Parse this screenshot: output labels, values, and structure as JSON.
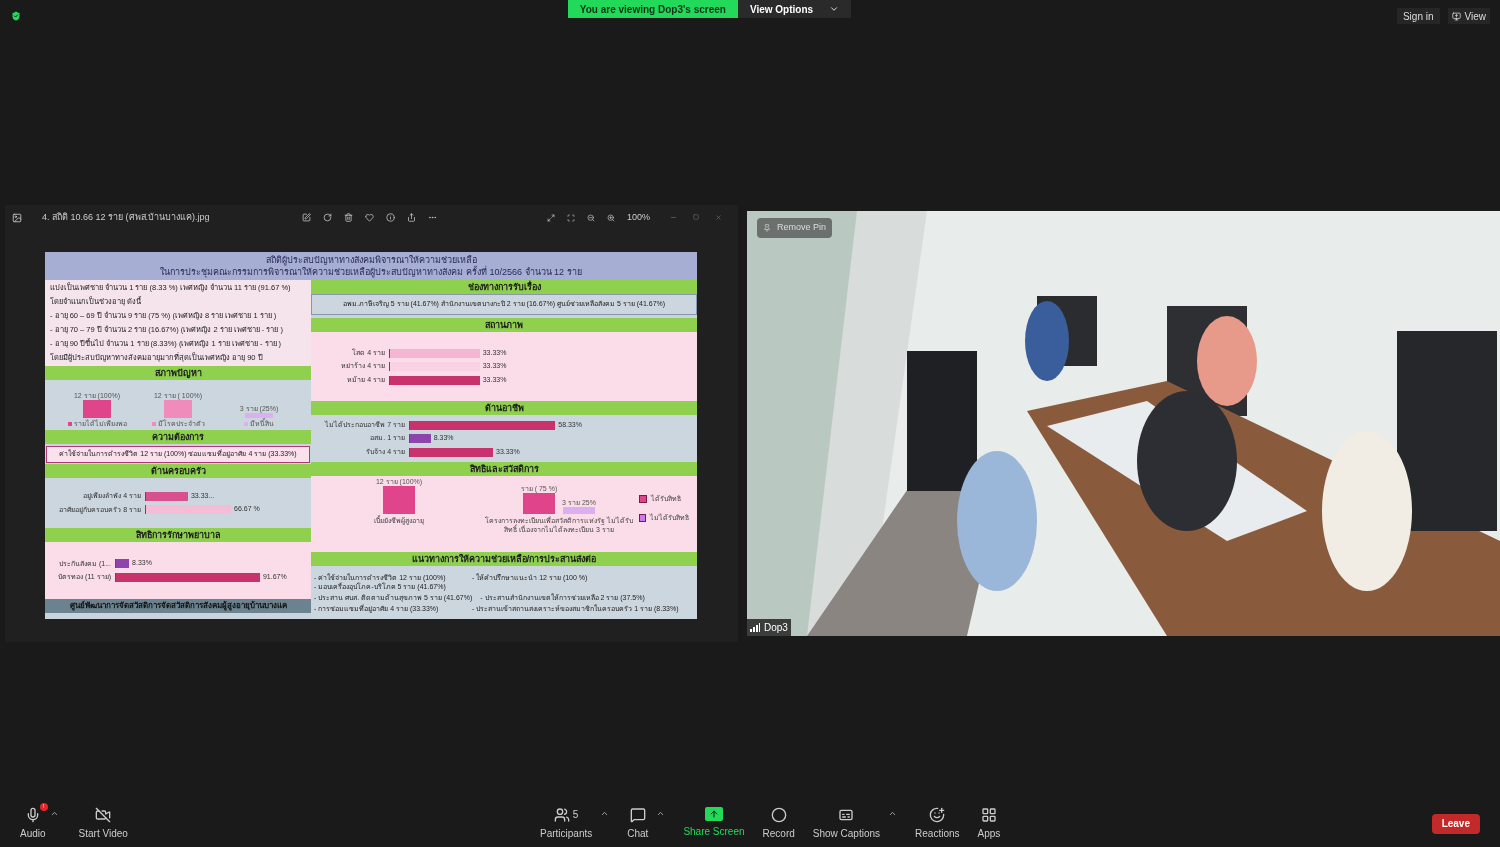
{
  "top_bar": {
    "banner": "You are viewing Dop3's screen",
    "view_options": "View Options",
    "sign_in": "Sign in",
    "view": "View"
  },
  "viewer": {
    "file_name": "4. สถิติ 10.66  12 ราย (ศพส.บ้านบางแค).jpg",
    "zoom": "100%"
  },
  "slide": {
    "title": [
      "สถิติผู้ประสบปัญหาทางสังคมพิจารณาให้ความช่วยเหลือ",
      "ในการประชุมคณะกรรมการพิจารณาให้ความช่วยเหลือผู้ประสบปัญหาทางสังคม ครั้งที่ 10/2566 จำนวน  12 ราย"
    ],
    "intro": [
      "แบ่งเป็นเพศชาย จำนวน 1 ราย (8.33 %) เพศหญิง จำนวน 11 ราย (91.67 %)",
      "โดยจำแนกเป็นช่วงอายุ ดังนี้",
      "-  อายุ 60 – 69 ปี จำนวน 9 ราย (75 %) (เพศหญิง 8 ราย เพศชาย 1 ราย )",
      "-  อายุ 70 – 79 ปี จำนวน 2 ราย (16.67%) (เพศหญิง 2 ราย เพศชาย - ราย )",
      "-  อายุ 90 ปีขึ้นไป จำนวน 1 ราย (8.33%) (เพศหญิง 1 ราย เพศชาย - ราย )",
      "โดยมีผู้ประสบปัญหาทางสังคมอายุมากที่สุดเป็นเพศหญิง อายุ 90 ปี"
    ],
    "problems": {
      "heading": "สภาพปัญหา",
      "bars": [
        {
          "value_label": "12 ราย (100%)",
          "color": "#e0448a"
        },
        {
          "value_label": "12 ราย ( 100%)",
          "color": "#f08cbc"
        },
        {
          "value_label": "3 ราย (25%)",
          "color": "#dcb0f0"
        }
      ],
      "legend": [
        "รายได้ไม่เพียงพอ",
        "มีโรคประจำตัว",
        "มีหนี้สิน"
      ]
    },
    "needs": {
      "heading": "ความต้องการ",
      "text": "ค่าใช้จ่ายในการดำรงชีวิต 12 ราย (100%)  ซ่อมแซมที่อยู่อาศัย 4 ราย (33.33%)"
    },
    "family": {
      "heading": "ด้านครอบครัว",
      "rows": [
        {
          "label": "อยู่เพียงลำพัง 4 ราย",
          "value": "33.33...",
          "level": 0.33,
          "color": "#d9508f"
        },
        {
          "label": "อาศัยอยู่กับครอบครัว 8 ราย",
          "value": "66.67  %",
          "level": 0.67,
          "color": "#f5bcd6"
        }
      ]
    },
    "medical": {
      "heading": "สิทธิการรักษาพยาบาล",
      "rows": [
        {
          "label": "ประกันสังคม (1...",
          "value": "8.33%",
          "level": 0.0833,
          "color": "#8e44ad"
        },
        {
          "label": "บัตรทอง (11 ราย)",
          "value": "91.67%",
          "level": 0.9167,
          "color": "#c8336e"
        }
      ]
    },
    "footer": "ศูนย์พัฒนาการจัดสวัสดิการจัดสวัสดิการสังคมผู้สูงอายุบ้านบางแค",
    "channels": {
      "heading": "ช่องทางการรับเรื่อง",
      "text": "อพม.ภาษีเจริญ 5 ราย (41.67%)   สำนักงานเขตบางกะปิ 2 ราย (16.67%)  ศูนย์ช่วยเหลือสังคม 5 ราย (41.67%)"
    },
    "status": {
      "heading": "สถานภาพ",
      "rows": [
        {
          "label": "โสด 4 ราย",
          "value": "33.33%",
          "level": 0.3333,
          "color": "#f4b6d2"
        },
        {
          "label": "หย่าร้าง 4 ราย",
          "value": "33.33%",
          "level": 0.3333,
          "color": "#f9d3e4"
        },
        {
          "label": "หม้าย 4 ราย",
          "value": "33.33%",
          "level": 0.3333,
          "color": "#c8336e"
        }
      ]
    },
    "occupation": {
      "heading": "ด้านอาชีพ",
      "rows": [
        {
          "label": "ไม่ได้ประกอบอาชีพ 7 ราย",
          "value": "58.33%",
          "level": 0.5833,
          "color": "#c8336e"
        },
        {
          "label": "อสม. 1 ราย",
          "value": "8.33%",
          "level": 0.0833,
          "color": "#8e44ad"
        },
        {
          "label": "รับจ้าง 4 ราย",
          "value": "33.33%",
          "level": 0.3333,
          "color": "#c8336e"
        }
      ]
    },
    "welfare": {
      "heading": "สิทธิและสวัสดิการ",
      "groups": [
        {
          "category": "เบี้ยยังชีพผู้สูงอายุ",
          "bars": [
            {
              "value_label": "12 ราย (100%)",
              "color": "#e0448a"
            }
          ]
        },
        {
          "category": "โครงการลงทะเบียนเพื่อสวัสดิการแห่งรัฐ ไม่ได้รับสิทธิ์ เนื่องจากไม่ได้ลงทะเบียน 3 ราย",
          "bars": [
            {
              "value_label": "ราย ( 75 %)",
              "color": "#e0448a"
            },
            {
              "value_label": "3 ราย 25%",
              "color": "#dcb0f0"
            }
          ]
        }
      ],
      "legend": [
        {
          "label": "ได้รับสิทธิ",
          "color": "#e0448a"
        },
        {
          "label": "ไม่ได้รับสิทธิ",
          "color": "#c87af0"
        }
      ]
    },
    "guidance": {
      "heading": "แนวทางการให้ความช่วยเหลือ/การประสานส่งต่อ",
      "lines": [
        [
          "- ค่าใช้จ่ายในการดำรงชีวิต  12 ราย (100%)",
          "- ให้คำปรึกษาแนะนำ 12 ราย (100 %)",
          "- มอบเครื่องอุปโภค-บริโภค  5 ราย (41.67%)"
        ],
        [
          "- ประสาน ศบส. ติดตามด้านสุขภาพ  5 ราย (41.67%)",
          "- ประสานสำนักงานเขตให้การช่วยเหลือ 2 ราย (37.5%)"
        ],
        [
          "- การซ่อมแซมที่อยู่อาศัย  4 ราย (33.33%)",
          "- ประสานเข้าสถานสงเคราะห์ของสมาชิกในครอบครัว  1 ราย (8.33%)"
        ]
      ]
    }
  },
  "video": {
    "remove_pin": "Remove Pin",
    "name": "Dop3"
  },
  "toolbar": {
    "left": [
      {
        "label": "Audio",
        "badge": "!",
        "menu": true
      },
      {
        "label": "Start Video",
        "menu": false
      }
    ],
    "center": [
      {
        "label": "Participants",
        "count": "5",
        "menu": true,
        "kind": "normal"
      },
      {
        "label": "Chat",
        "menu": true,
        "kind": "normal"
      },
      {
        "label": "Share Screen",
        "menu": false,
        "kind": "share"
      },
      {
        "label": "Record",
        "menu": false,
        "kind": "normal"
      },
      {
        "label": "Show Captions",
        "menu": true,
        "kind": "normal"
      },
      {
        "label": "Reactions",
        "menu": false,
        "kind": "normal"
      },
      {
        "label": "Apps",
        "menu": false,
        "kind": "normal"
      }
    ],
    "leave": "Leave"
  }
}
